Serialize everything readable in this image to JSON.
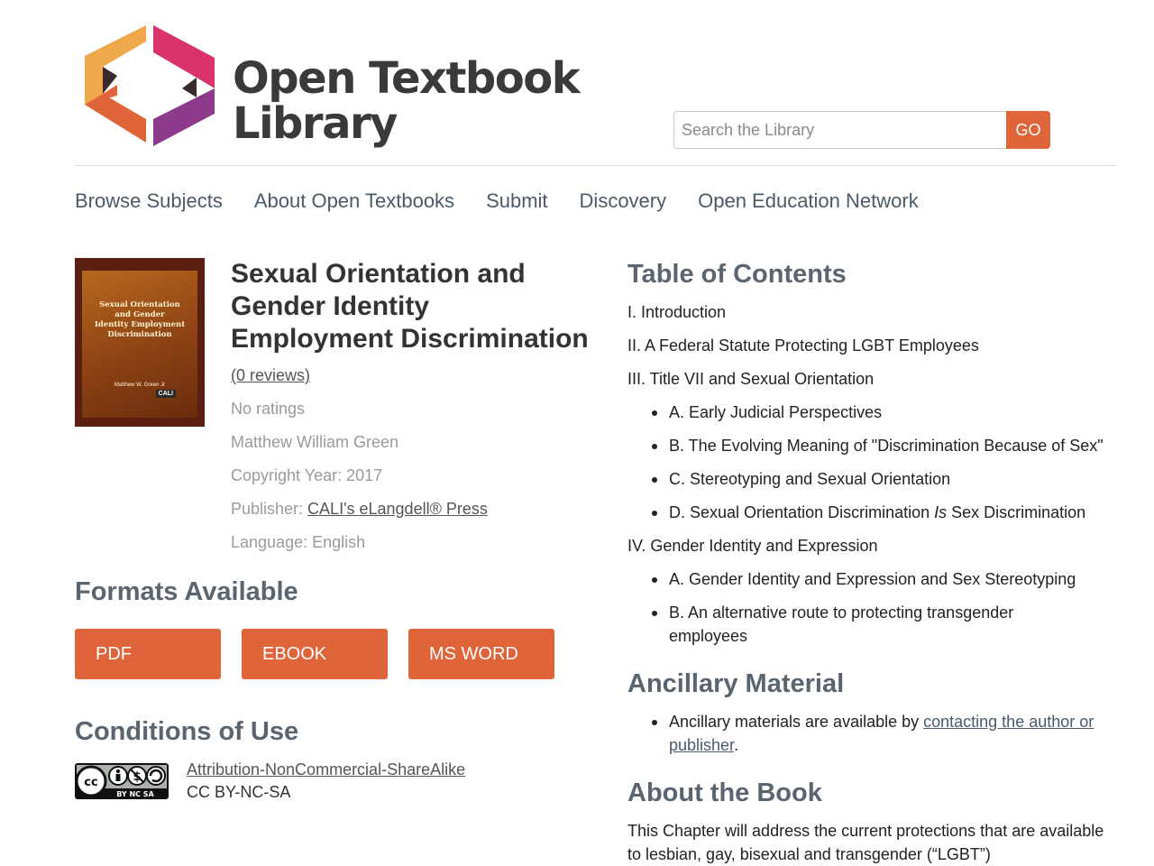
{
  "brand": {
    "line1": "Open Textbook",
    "line2": "Library"
  },
  "search": {
    "placeholder": "Search the Library",
    "button": "GO"
  },
  "nav": [
    "Browse Subjects",
    "About Open Textbooks",
    "Submit",
    "Discovery",
    "Open Education Network"
  ],
  "cover": {
    "title_lines": [
      "Sexual Orientation",
      "and Gender",
      "Identity Employment",
      "Discrimination"
    ],
    "author": "Matthew W. Green Jr",
    "publisher_mark": "CALI"
  },
  "book": {
    "title": "Sexual Orientation and Gender Identity Employment Discrimination",
    "reviews": "(0 reviews)",
    "ratings": "No ratings",
    "author": "Matthew William Green",
    "copyright": "Copyright Year: 2017",
    "publisher_label": "Publisher: ",
    "publisher": "CALI's eLangdell® Press",
    "language": "Language: English"
  },
  "formats": {
    "heading": "Formats Available",
    "buttons": [
      "PDF",
      "EBOOK",
      "MS WORD"
    ]
  },
  "conditions": {
    "heading": "Conditions of Use",
    "badge_text": "BY  NC  SA",
    "license_link": "Attribution-NonCommercial-ShareAlike",
    "license_code": "CC BY-NC-SA"
  },
  "toc": {
    "heading": "Table of Contents",
    "items": [
      "I. Introduction",
      "II. A Federal Statute Protecting LGBT Employees",
      "III. Title VII and Sexual Orientation",
      "A. Early Judicial Perspectives",
      "B. The Evolving Meaning of \"Discrimination Because of Sex\"",
      "C. Stereotyping and Sexual Orientation",
      "D. Sexual Orientation Discrimination ",
      "Is",
      " Sex Discrimination",
      "IV. Gender Identity and Expression",
      "A. Gender Identity and Expression and Sex Stereotyping",
      "B. An alternative route to protecting transgender employees"
    ]
  },
  "ancillary": {
    "heading": "Ancillary Material",
    "text": "Ancillary materials are available by ",
    "link": "contacting the author or publisher",
    "end": "."
  },
  "about": {
    "heading": "About the Book",
    "text": "This Chapter will address the current protections that are available to lesbian, gay, bisexual and transgender (“LGBT”)"
  },
  "colors": {
    "accent": "#e0643a",
    "nav": "#4a5a6a",
    "heading": "#5a6570",
    "muted": "#9a9a9a"
  }
}
